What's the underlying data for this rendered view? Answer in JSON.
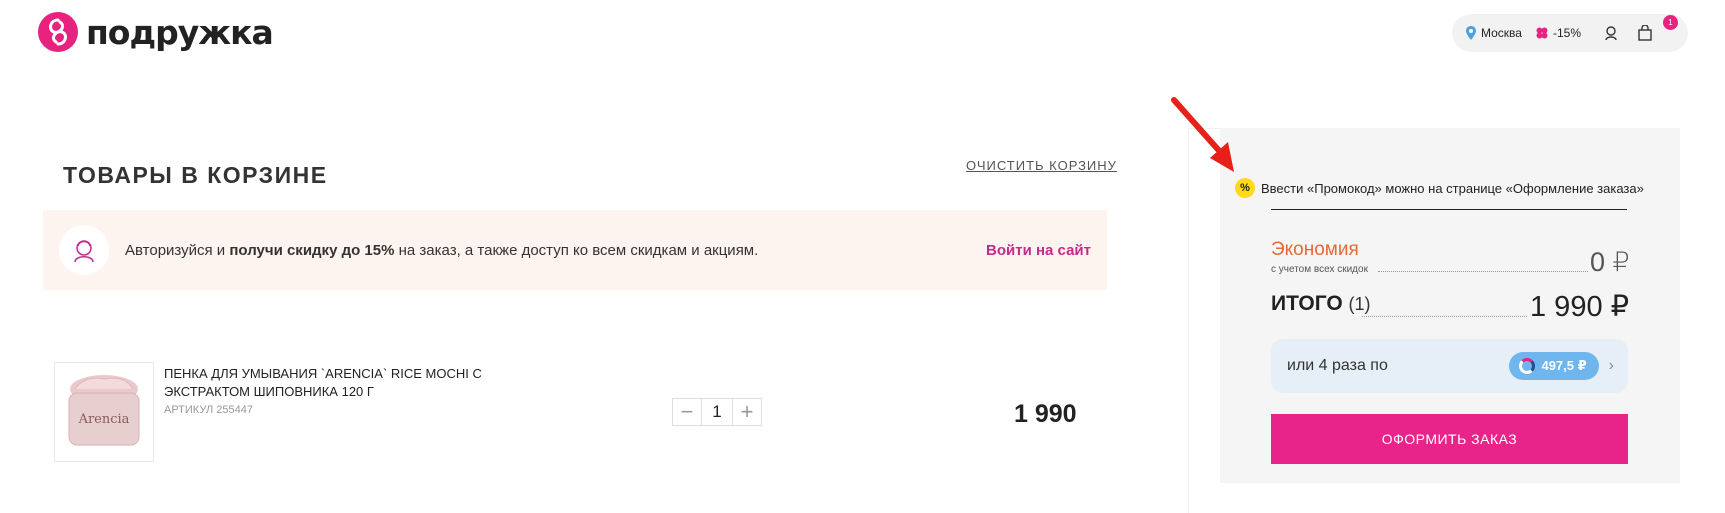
{
  "header": {
    "logo_text": "подружка",
    "city": "Москва",
    "discount": "-15%",
    "cart_count": "1",
    "brand_color": "#e8237f"
  },
  "cart": {
    "title": "ТОВАРЫ В КОРЗИНЕ",
    "clear_label": "ОЧИСТИТЬ КОРЗИНУ"
  },
  "promo_banner": {
    "text_prefix": "Авторизуйся и ",
    "text_bold": "получи скидку до 15%",
    "text_suffix": " на заказ, а также доступ ко всем скидкам и акциям.",
    "login_label": "Войти на сайт"
  },
  "product": {
    "name": "ПЕНКА ДЛЯ УМЫВАНИЯ `ARENCIA` RICE MOCHI С ЭКСТРАКТОМ ШИПОВНИКА 120 Г",
    "sku": "АРТИКУЛ 255447",
    "quantity": "1",
    "price": "1 990",
    "image_label": "Arencia"
  },
  "summary": {
    "promo_note": "Ввести «Промокод» можно на странице «Оформление заказа»",
    "economy_label": "Экономия",
    "economy_sub": "с учетом всех скидок",
    "economy_value": "0 ₽",
    "total_label": "ИТОГО",
    "total_count": "(1)",
    "total_value": "1 990 ₽",
    "split_text": "или 4 раза по",
    "split_amount": "497,5 ₽",
    "checkout_label": "ОФОРМИТЬ ЗАКАЗ"
  }
}
